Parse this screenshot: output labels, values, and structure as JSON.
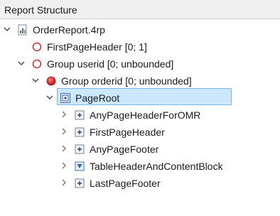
{
  "panel": {
    "title": "Report Structure"
  },
  "tree": {
    "root": {
      "label": "OrderReport.4rp",
      "icon": "report-file-icon"
    },
    "items": [
      {
        "label": "FirstPageHeader [0; 1]",
        "icon": "empty-circle-icon"
      },
      {
        "label": "Group userid [0; unbounded]",
        "icon": "empty-circle-icon"
      },
      {
        "label": "Group orderid [0; unbounded]",
        "icon": "filled-red-circle-icon"
      },
      {
        "label": "PageRoot",
        "icon": "page-root-icon"
      },
      {
        "label": "AnyPageHeaderForOMR",
        "icon": "plus-box-icon"
      },
      {
        "label": "FirstPageHeader",
        "icon": "plus-box-icon"
      },
      {
        "label": "AnyPageFooter",
        "icon": "plus-box-icon"
      },
      {
        "label": "TableHeaderAndContentBlock",
        "icon": "down-arrow-box-icon"
      },
      {
        "label": "LastPageFooter",
        "icon": "plus-box-icon"
      }
    ]
  },
  "colors": {
    "selection_fill": "#cce8ff",
    "selection_border": "#7fb4e5",
    "circle_red": "#d42020"
  }
}
